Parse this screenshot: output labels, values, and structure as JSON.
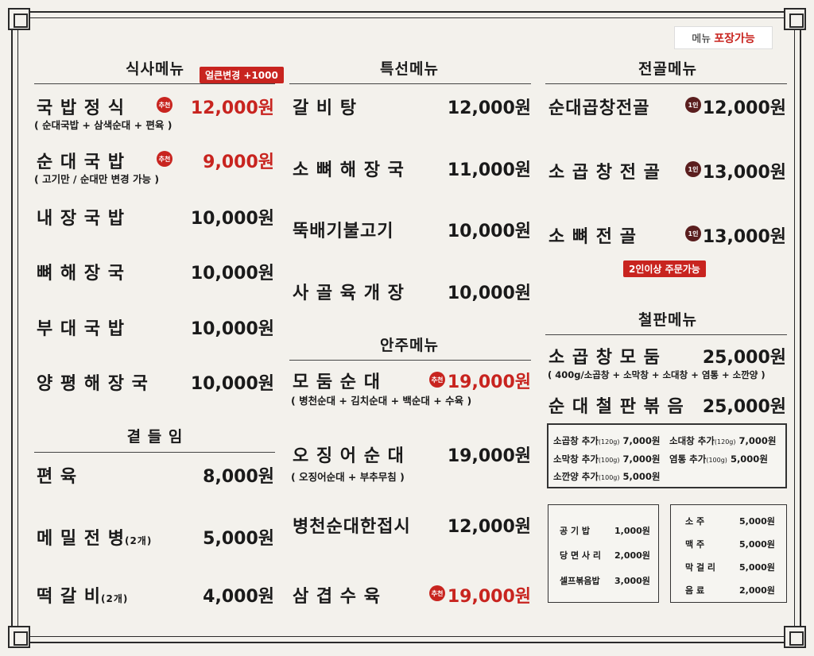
{
  "header": {
    "takeout_prefix": "메뉴",
    "takeout_highlight": "포장가능"
  },
  "meal": {
    "title": "식사메뉴",
    "badge": "얼큰변경 +1000",
    "items": [
      {
        "name": "국 밥 정 식",
        "price": "12,000원",
        "tag": "추천",
        "sub": "( 순대국밥 + 삼색순대 + 편육 )"
      },
      {
        "name": "순 대 국 밥",
        "price": "9,000원",
        "tag": "추천",
        "sub": "( 고기만 / 순대만 변경 가능 )"
      },
      {
        "name": "내 장 국 밥",
        "price": "10,000원"
      },
      {
        "name": "뼈 해 장 국",
        "price": "10,000원"
      },
      {
        "name": "부 대 국 밥",
        "price": "10,000원"
      },
      {
        "name": "양 평 해 장 국",
        "price": "10,000원"
      }
    ]
  },
  "side": {
    "title": "곁 들 임",
    "items": [
      {
        "name": "편          육",
        "price": "8,000원"
      },
      {
        "name": "메 밀 전 병",
        "count": "(2개)",
        "price": "5,000원"
      },
      {
        "name": "떡     갈     비",
        "count": "(2개)",
        "price": "4,000원"
      }
    ]
  },
  "special": {
    "title": "특선메뉴",
    "items": [
      {
        "name": "갈      비      탕",
        "price": "12,000원"
      },
      {
        "name": "소 뼈 해 장 국",
        "price": "11,000원"
      },
      {
        "name": "뚝배기불고기",
        "price": "10,000원"
      },
      {
        "name": "사 골 육 개 장",
        "price": "10,000원"
      }
    ]
  },
  "snack": {
    "title": "안주메뉴",
    "items": [
      {
        "name": "모   둠   순   대",
        "price": "19,000원",
        "tag": "추천",
        "sub": "( 병천순대 + 김치순대 + 백순대 + 수육 )"
      },
      {
        "name": "오 징 어 순 대",
        "price": "19,000원",
        "sub": "( 오징어순대 + 부추무침 )"
      },
      {
        "name": "병천순대한접시",
        "price": "12,000원"
      },
      {
        "name": "삼   겹   수   육",
        "price": "19,000원",
        "tag": "추천"
      }
    ]
  },
  "hotpot": {
    "title": "전골메뉴",
    "items": [
      {
        "name": "순대곱창전골",
        "tag": "1인",
        "price": "12,000원"
      },
      {
        "name": "소 곱 창 전 골",
        "tag": "1인",
        "price": "13,000원"
      },
      {
        "name": "소   뼈   전   골",
        "tag": "1인",
        "price": "13,000원"
      }
    ],
    "badge": "2인이상 주문가능"
  },
  "griddle": {
    "title": "철판메뉴",
    "items": [
      {
        "name": "소 곱 창 모 둠",
        "price": "25,000원",
        "sub": "( 400g/소곱창 + 소막창 + 소대창 + 염통 + 소깐양 )"
      },
      {
        "name": "순 대 철 판 볶 음",
        "price": "25,000원"
      }
    ]
  },
  "addons": [
    {
      "name": "소곱창 추가",
      "g": "(120g)",
      "price": "7,000원"
    },
    {
      "name": "소대창 추가",
      "g": "(120g)",
      "price": "7,000원"
    },
    {
      "name": "소막창 추가",
      "g": "(100g)",
      "price": "7,000원"
    },
    {
      "name": "염통 추가",
      "g": "(100g)",
      "price": "5,000원"
    },
    {
      "name": "소깐양 추가",
      "g": "(100g)",
      "price": "5,000원"
    }
  ],
  "extras": [
    {
      "name": "공  기  밥",
      "price": "1,000원"
    },
    {
      "name": "당 면 사 리",
      "price": "2,000원"
    },
    {
      "name": "셀프볶음밥",
      "price": "3,000원"
    }
  ],
  "drinks": [
    {
      "name": "소      주",
      "price": "5,000원"
    },
    {
      "name": "맥      주",
      "price": "5,000원"
    },
    {
      "name": "막 걸 리",
      "price": "5,000원"
    },
    {
      "name": "음      료",
      "price": "2,000원"
    }
  ]
}
